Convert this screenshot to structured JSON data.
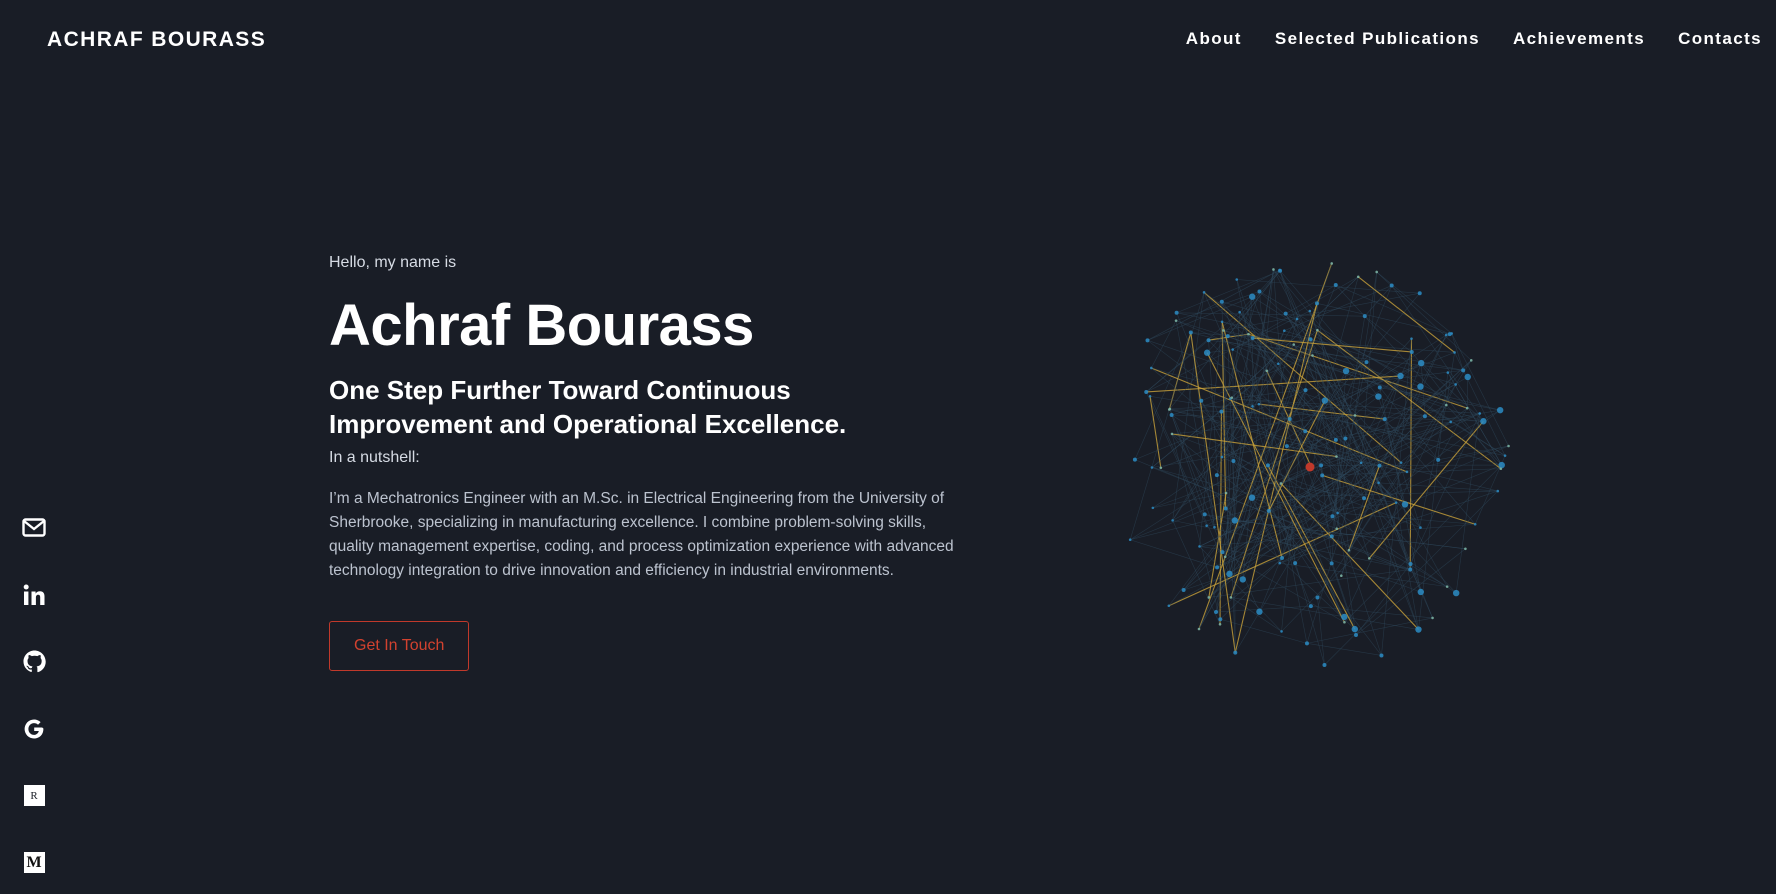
{
  "header": {
    "logo": "ACHRAF BOURASS",
    "nav": [
      "About",
      "Selected Publications",
      "Achievements",
      "Contacts"
    ]
  },
  "social": {
    "icons": [
      "mail-icon",
      "linkedin-icon",
      "github-icon",
      "google-scholar-icon",
      "researchgate-icon",
      "medium-icon"
    ],
    "researchgate_label": "R",
    "medium_label": "M"
  },
  "hero": {
    "greeting": "Hello, my name is",
    "name": "Achraf Bourass",
    "tagline": "One Step Further Toward Continuous Improvement and Operational Excellence.",
    "nutshell": "In a nutshell:",
    "bio": "I’m a Mechatronics Engineer with an M.Sc. in Electrical Engineering from the University of Sherbrooke, specializing in manufacturing excellence. I combine problem-solving skills, quality management expertise, coding, and process optimization experience with advanced technology integration to drive innovation and efficiency in industrial environments.",
    "cta_label": "Get In Touch"
  },
  "colors": {
    "background": "#191d26",
    "accent": "#d2422f",
    "node_blue": "#2b8cc4",
    "node_teal": "#7fb9a8",
    "node_gold": "#c9a23a",
    "node_red": "#c0392b",
    "edge": "#2f4a5e"
  }
}
